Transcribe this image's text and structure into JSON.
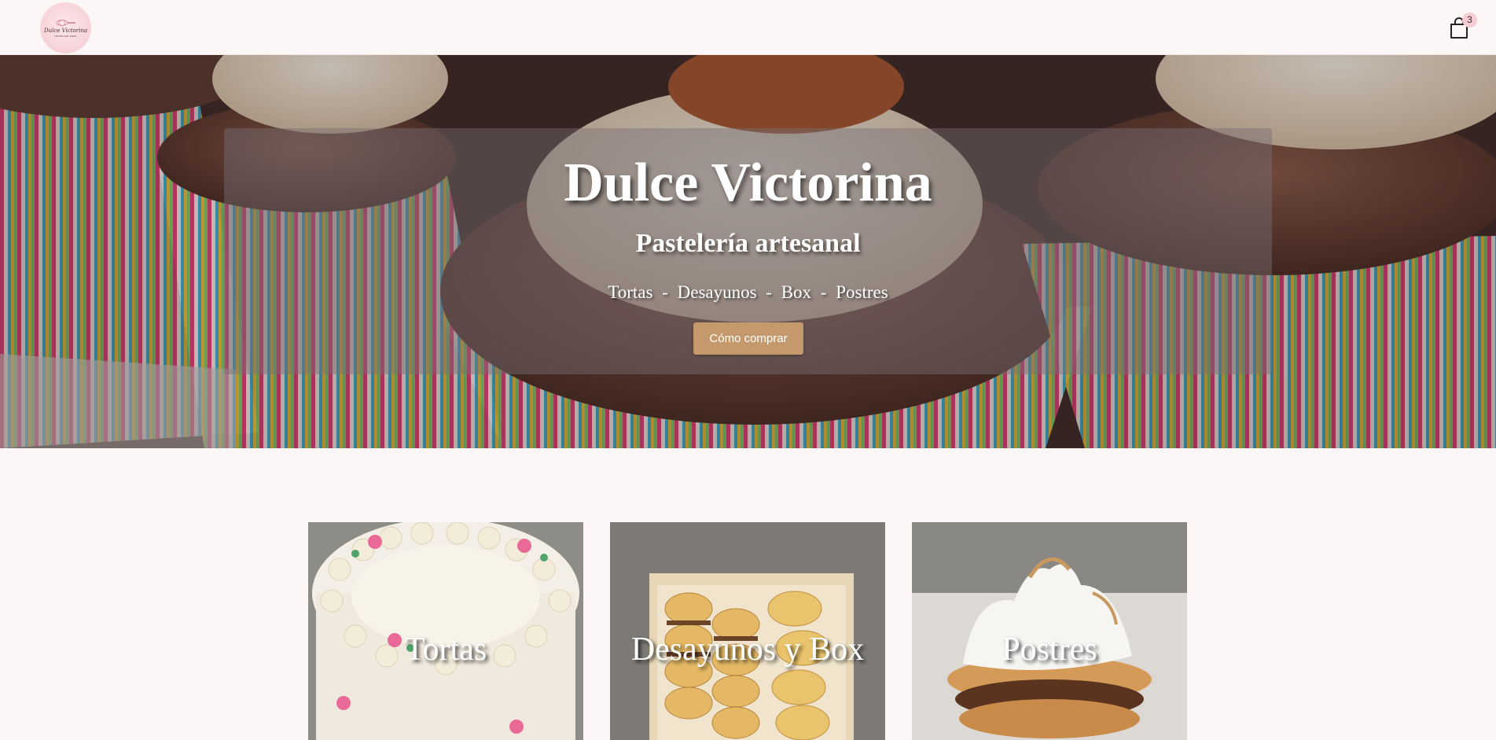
{
  "header": {
    "logo": {
      "name": "Dulce Victorina",
      "tagline": "hecho con amor"
    },
    "cart": {
      "icon": "shopping-bag-icon",
      "count": "3"
    }
  },
  "hero": {
    "title": "Dulce Victorina",
    "subtitle": "Pastelería artesanal",
    "categories_line": "Tortas - Desayunos - Box - Postres",
    "button_label": "Cómo comprar"
  },
  "categories": [
    {
      "label": "Tortas"
    },
    {
      "label": "Desayunos y Box"
    },
    {
      "label": "Postres"
    }
  ],
  "colors": {
    "background": "#fdf6f6",
    "accent_button": "#c49a6c",
    "badge": "#f6cdd3"
  }
}
